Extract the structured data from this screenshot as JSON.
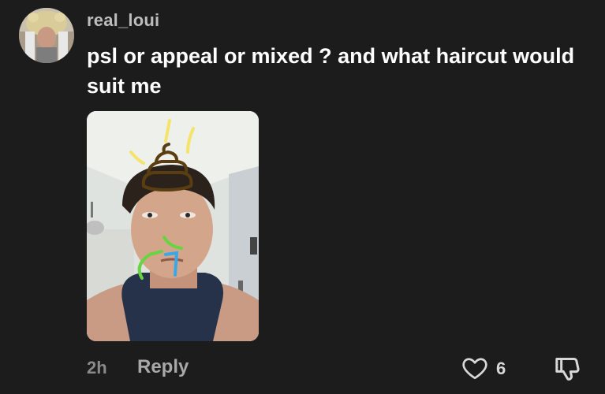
{
  "comment": {
    "username": "real_loui",
    "text": "psl or appeal or mixed ? and what haircut would suit me",
    "timestamp": "2h",
    "reply_label": "Reply",
    "like_count": "6"
  },
  "icons": {
    "like": "heart-outline-icon",
    "dislike": "thumbs-down-icon"
  },
  "colors": {
    "background": "#1c1c1c",
    "username": "#bdbdbd",
    "text": "#ffffff",
    "muted": "#8a8a8a"
  }
}
